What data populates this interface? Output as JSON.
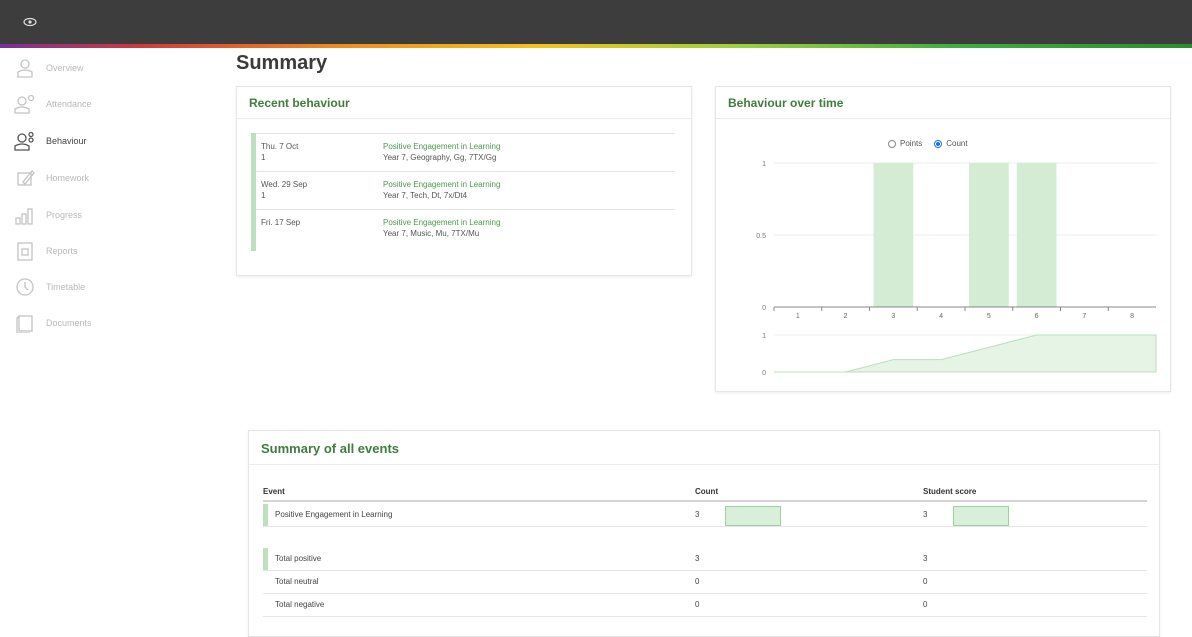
{
  "app": {
    "logo_icon": "eye-icon"
  },
  "colors": {
    "accent_green": "#3f7d3f",
    "bar_fill": "#d4ecd4",
    "topbar": "#3d3d3d"
  },
  "sidebar": {
    "items": [
      {
        "label": "Overview",
        "icon": "person-icon",
        "active": false
      },
      {
        "label": "Attendance",
        "icon": "person-check-icon",
        "active": false
      },
      {
        "label": "Behaviour",
        "icon": "person-swap-icon",
        "active": true
      },
      {
        "label": "Homework",
        "icon": "pencil-book-icon",
        "active": false
      },
      {
        "label": "Progress",
        "icon": "bar-chart-icon",
        "active": false
      },
      {
        "label": "Reports",
        "icon": "report-icon",
        "active": false
      },
      {
        "label": "Timetable",
        "icon": "clock-icon",
        "active": false
      },
      {
        "label": "Documents",
        "icon": "document-icon",
        "active": false
      }
    ]
  },
  "page": {
    "title": "Summary"
  },
  "recent_behaviour": {
    "title": "Recent behaviour",
    "items": [
      {
        "date": "Thu. 7 Oct",
        "sub": "1",
        "type": "Positive Engagement in Learning",
        "detail": "Year 7, Geography, Gg, 7TX/Gg"
      },
      {
        "date": "Wed. 29 Sep",
        "sub": "1",
        "type": "Positive Engagement in Learning",
        "detail": "Year 7, Tech, Dt, 7x/Dt4"
      },
      {
        "date": "Fri. 17 Sep",
        "sub": "",
        "type": "Positive Engagement in Learning",
        "detail": "Year 7, Music, Mu, 7TX/Mu"
      }
    ]
  },
  "behaviour_over_time": {
    "title": "Behaviour over time",
    "radio_points": "Points",
    "radio_count": "Count",
    "selected": "Count"
  },
  "chart_data": {
    "type": "bar",
    "categories": [
      "1",
      "2",
      "3",
      "4",
      "5",
      "6",
      "7",
      "8"
    ],
    "values": [
      0,
      0,
      1,
      0,
      1,
      1,
      0,
      0
    ],
    "ylim": [
      0,
      1
    ],
    "yticks": [
      "0",
      "0.5",
      "1"
    ],
    "grid": true,
    "navigator": {
      "type": "area",
      "values": [
        0,
        0,
        1,
        1,
        2,
        3,
        3,
        3
      ],
      "yticks": [
        "0",
        "1"
      ]
    }
  },
  "summary": {
    "title": "Summary of all events",
    "headers": {
      "event": "Event",
      "count": "Count",
      "score": "Student score"
    },
    "rows": [
      {
        "event": "Positive Engagement in Learning",
        "count": "3",
        "score": "3",
        "bar_fraction": 1,
        "bar": true
      }
    ],
    "totals": [
      {
        "event": "Total positive",
        "count": "3",
        "score": "3",
        "bar": true
      },
      {
        "event": "Total neutral",
        "count": "0",
        "score": "0",
        "bar": false
      },
      {
        "event": "Total negative",
        "count": "0",
        "score": "0",
        "bar": false
      }
    ]
  }
}
